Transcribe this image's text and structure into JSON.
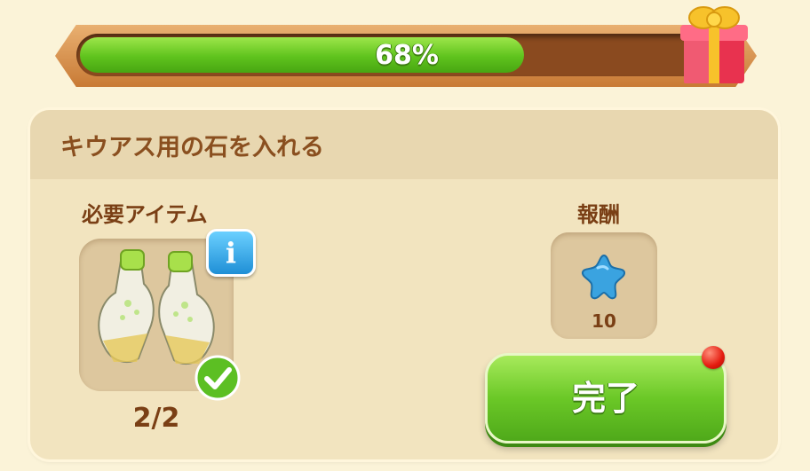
{
  "progress": {
    "label": "68%",
    "value": 0.68,
    "fill_color": "#5fc31d"
  },
  "gift": {
    "icon": "gift-box-icon"
  },
  "quest": {
    "title": "キウアス用の石を入れる",
    "required_label": "必要アイテム",
    "required_item": {
      "icon": "gloves-icon",
      "count": "2/2",
      "completed": true
    },
    "info_icon": "info-icon",
    "info_label": "i",
    "reward_label": "報酬",
    "reward": {
      "icon": "blue-star-icon",
      "amount": "10"
    },
    "complete_button": "完了",
    "has_notification": true
  }
}
